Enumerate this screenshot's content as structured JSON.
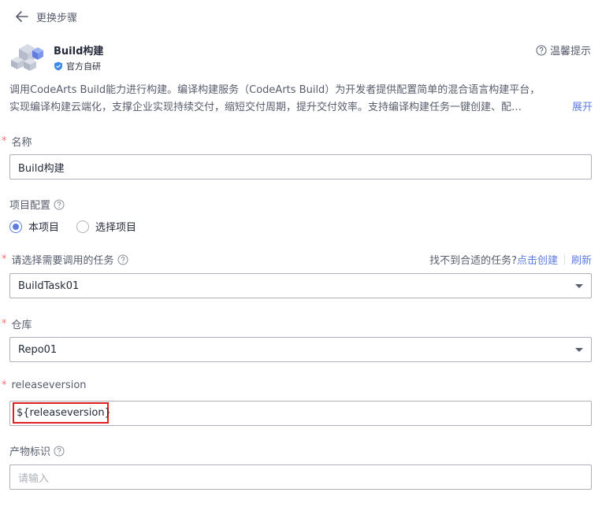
{
  "nav": {
    "back_label": "更换步骤"
  },
  "plugin": {
    "name": "Build构建",
    "badge": "官方自研",
    "tips_label": "温馨提示",
    "description_line1": "调用CodeArts Build能力进行构建。编译构建服务（CodeArts Build）为开发者提供配置简单的混合语言构建平台，",
    "description_line2": "实现编译构建云端化，支撑企业实现持续交付，缩短交付周期，提升交付效率。支持编译构建任务一键创建、配…",
    "expand_label": "展开"
  },
  "form": {
    "name": {
      "label": "名称",
      "required": "*",
      "value": "Build构建"
    },
    "project_config": {
      "label": "项目配置",
      "options": [
        "本项目",
        "选择项目"
      ],
      "selected": "本项目"
    },
    "task": {
      "label": "请选择需要调用的任务",
      "required": "*",
      "value": "BuildTask01",
      "not_found_text": "找不到合适的任务?",
      "create_link": "点击创建",
      "refresh_link": "刷新"
    },
    "repo": {
      "label": "仓库",
      "required": "*",
      "value": "Repo01"
    },
    "releaseversion": {
      "label": "releaseversion",
      "required": "*",
      "value": "${releaseversion}"
    },
    "artifact": {
      "label": "产物标识",
      "placeholder": "请输入"
    }
  },
  "colors": {
    "accent": "#5e7ce0",
    "required": "#f66f6a",
    "highlight_border": "#e02020"
  },
  "icons": {
    "back": "arrow-left-icon",
    "logo": "build-cubes-logo",
    "badge": "official-shield-icon",
    "help": "question-circle-icon"
  }
}
